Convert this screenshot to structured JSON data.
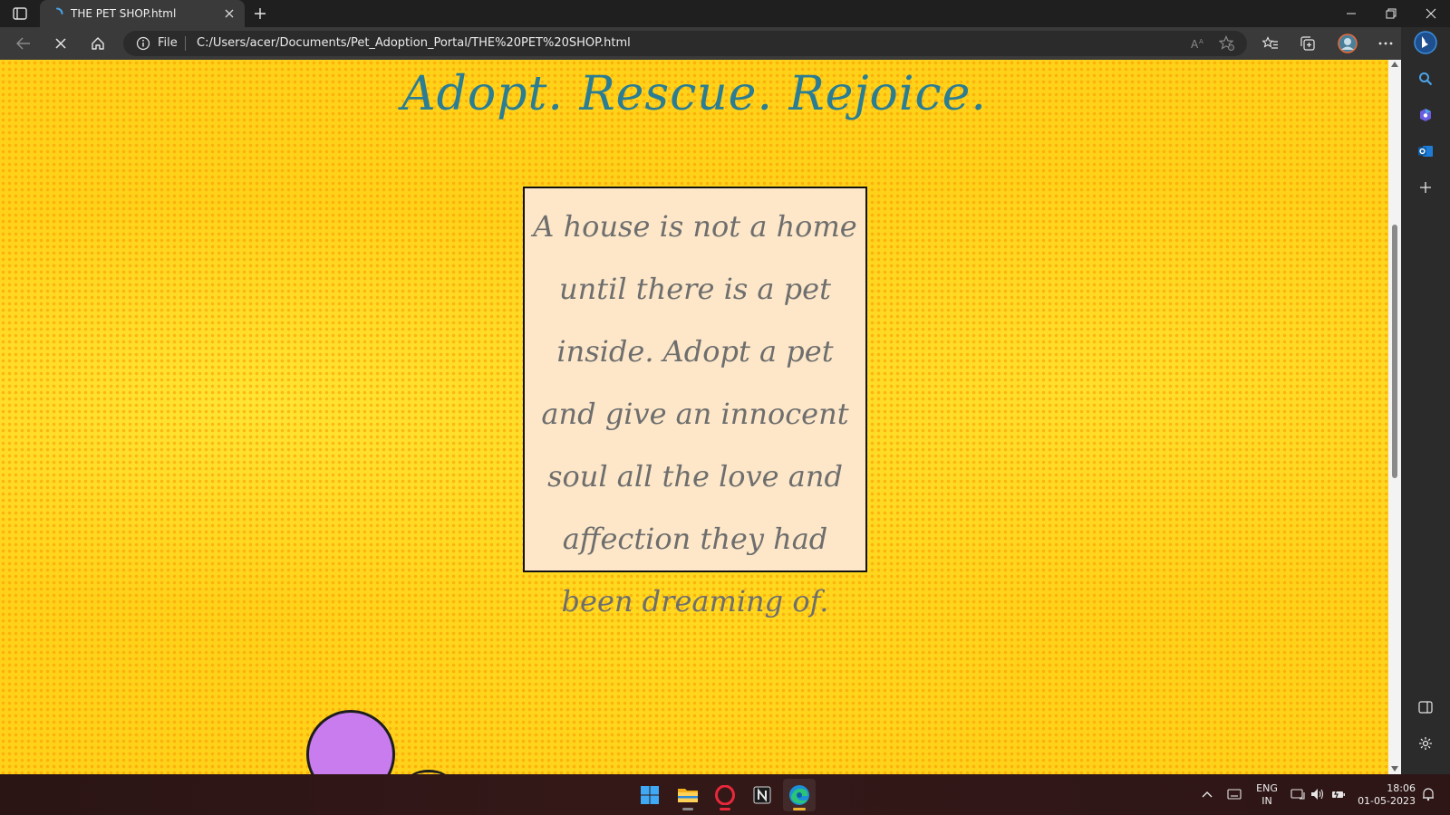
{
  "browser": {
    "tab": {
      "title": "THE PET SHOP.html"
    },
    "address": {
      "scheme": "File",
      "url": "C:/Users/acer/Documents/Pet_Adoption_Portal/THE%20PET%20SHOP.html"
    }
  },
  "page": {
    "tagline": "Adopt. Rescue. Rejoice.",
    "quote": "A house is not a home until there is a pet inside. Adopt a pet and give an innocent soul all the love and affection they had been dreaming of."
  },
  "taskbar": {
    "language": {
      "line1": "ENG",
      "line2": "IN"
    },
    "clock": {
      "time": "18:06",
      "date": "01-05-2023"
    }
  },
  "colors": {
    "page_background": "#ffd21a",
    "tagline": "#2a7d93",
    "quote_box": "#fde7c8",
    "quote_text": "#6e6e6e",
    "pet_ball": "#c87cee"
  }
}
